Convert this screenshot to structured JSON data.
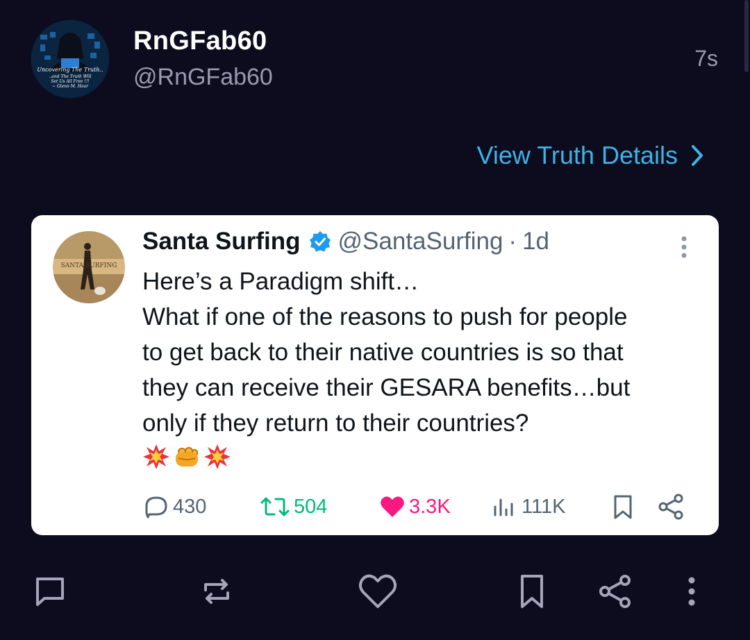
{
  "post": {
    "display_name": "RnGFab60",
    "handle": "@RnGFab60",
    "time": "7s",
    "avatar_text": [
      "Uncovering The Truth..",
      "..and The Truth Will",
      "Set Us All Free !!!",
      "~ Glenn M. Hoar"
    ],
    "view_details_label": "View Truth Details"
  },
  "embed": {
    "name": "Santa Surfing",
    "handle": "@SantaSurfing",
    "separator": "·",
    "time": "1d",
    "avatar_text": "SANTA SURFING",
    "text_lines": [
      "Here’s a Paradigm shift…",
      "What if one of the reasons to push for people",
      "to get back to their native countries is so that",
      "they can receive their GESARA benefits…but",
      "only if they return to their countries?"
    ],
    "emojis": [
      "collision-emoji",
      "fist-emoji",
      "collision-emoji"
    ],
    "metrics": {
      "replies": "430",
      "reposts": "504",
      "likes": "3.3K",
      "views": "111K"
    }
  },
  "colors": {
    "background": "#0d0b1e",
    "link": "#3bb4e6",
    "repost": "#00ba7c",
    "like": "#f91880",
    "verified": "#1d9bf0"
  },
  "icons": [
    "reply-icon",
    "repost-icon",
    "like-icon",
    "bookmark-icon",
    "share-icon",
    "more-icon"
  ]
}
